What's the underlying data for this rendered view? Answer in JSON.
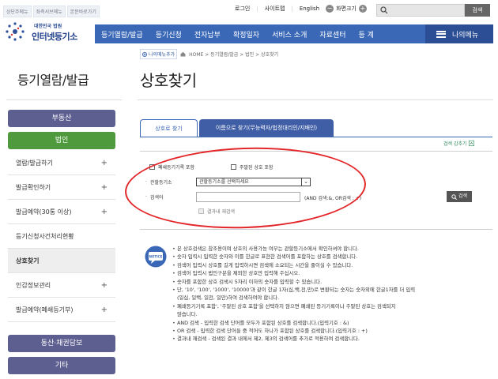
{
  "skip_links": [
    "상단주메뉴",
    "좌측서브메뉴",
    "본문바로가기"
  ],
  "utility": {
    "login": "로그인",
    "sitemap": "사이트맵",
    "english": "English",
    "zoom_minus": "−",
    "zoom_label": "화면크기",
    "zoom_plus": "+",
    "search_button": "검색"
  },
  "logo": {
    "small": "대한민국 법원",
    "big": "인터넷등기소"
  },
  "gnb": {
    "items": [
      "등기열람/발급",
      "등기신청",
      "전자납부",
      "확정일자",
      "서비스 소개",
      "자료센터",
      "등 계"
    ],
    "all_menu": "나의메뉴"
  },
  "sidebar": {
    "title": "등기열람/발급",
    "buttons": {
      "realestate": "부동산",
      "corporation": "법인",
      "movable": "동산·채권담보",
      "etc": "기타"
    },
    "items": [
      {
        "label": "열람/발급하기",
        "plus": "+"
      },
      {
        "label": "발급확인하기",
        "plus": "+"
      },
      {
        "label": "발급예약(30통 이상)",
        "plus": "+"
      },
      {
        "label": "등기신청사건처리현황",
        "plus": ""
      },
      {
        "label": "상호찾기",
        "plus": ""
      },
      {
        "label": "인감정보관리",
        "plus": "+"
      },
      {
        "label": "발급예약(폐쇄등기부)",
        "plus": "+"
      }
    ]
  },
  "breadcrumb": {
    "my_add": "나의메뉴추가",
    "path": "HOME > 등기열람/발급 > 법인 > 상호찾기"
  },
  "page_title": "상호찾기",
  "tabs": [
    "상호로 찾기",
    "이름으로 찾기(무능력자/법정대리인/지배인)"
  ],
  "collapse_label": "검색 감추기",
  "form": {
    "closed_include": "폐쇄등기기록 포함",
    "main_office_include": "주말된 상호 포함",
    "registry_label": "관할등기소",
    "registry_value": "관할등기소를 선택하세요",
    "search_label": "검색어",
    "search_value": "",
    "search_hint": "(AND 검색:&, OR검색 : +)",
    "search_button": "검색",
    "research_label": "결과내 재검색"
  },
  "notice": {
    "icon_label": "NOTICE",
    "lines": [
      "본 상호검색은 참조용이며 상호의 사용가능 여부는 관할등기소에서 확인하셔야 합니다.",
      "숫자 입력시 입력한 숫자와 이를 한글로 표현한 검색어를 포함하는 상호를 검색합니다.",
      "검색어 입력시 상호를 길게 입력하시면 검색에 소요되는 시간을 줄이실 수 있습니다.",
      "검색어 입력시 법인구분을 제외한 상호만 입력해 주십시오.",
      "숫자를 포함한 상호 검색시 5자리 이하의 숫자를 입력할 수 있습니다.",
      "단, '10', '100', '1000', '10000'과 같이 한글 1자(십,백,천,만)로 변환되는 숫자는 숫자외에 한글1자를 더 입력",
      "(일십, 일백, 일천, 일만)하여 검색하여야 합니다.",
      "폐쇄등기기록 포함', '주말된 상호 포함'을 선택하지 않으면 폐쇄된 등기기록이나 주말된 상호는 검색되지",
      "않습니다.",
      "AND 검색 - 입력한 검색 단어를 모두가 포함된 상호를 검색합니다.(입력기호 : &)",
      "OR 검색 - 입력한 검색 단어들 중 적어도 하나가 포함된 상호를 검색합니다.(입력기호 : +)",
      "결과내 재검색 - 검색된 결과 내에서 제2, 제3의 검색어를 추가로 적용하여 검색합니다."
    ]
  },
  "colors": {
    "brand_blue": "#3a68b7",
    "sidebar_dark": "#5d5f91",
    "sidebar_green": "#4f9a3d",
    "annotation_red": "#e3262a"
  }
}
